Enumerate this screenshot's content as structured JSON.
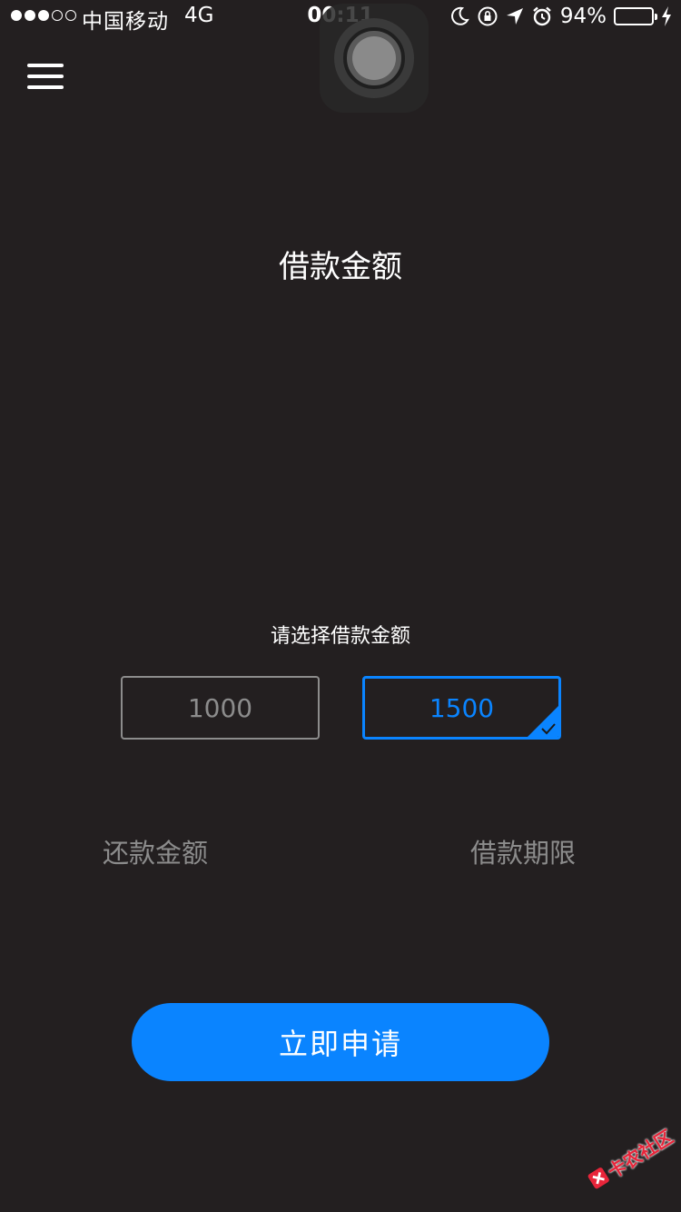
{
  "status_bar": {
    "carrier": "中国移动",
    "network": "4G",
    "time": "00:11",
    "battery_percent": "94%",
    "battery_level": 0.94,
    "signal_strength": 3,
    "signal_max": 5,
    "battery_color": "#4cd964"
  },
  "header": {
    "menu_icon": "hamburger-menu-icon"
  },
  "main": {
    "title": "借款金额",
    "prompt": "请选择借款金额",
    "amount_options": [
      {
        "label": "1000",
        "selected": false
      },
      {
        "label": "1500",
        "selected": true
      }
    ],
    "repay_amount_label": "还款金额",
    "loan_term_label": "借款期限"
  },
  "actions": {
    "apply_label": "立即申请"
  },
  "watermark": {
    "text": "卡农社区"
  },
  "colors": {
    "background": "#231f20",
    "accent": "#0a84ff",
    "muted": "#8c8c8c"
  }
}
